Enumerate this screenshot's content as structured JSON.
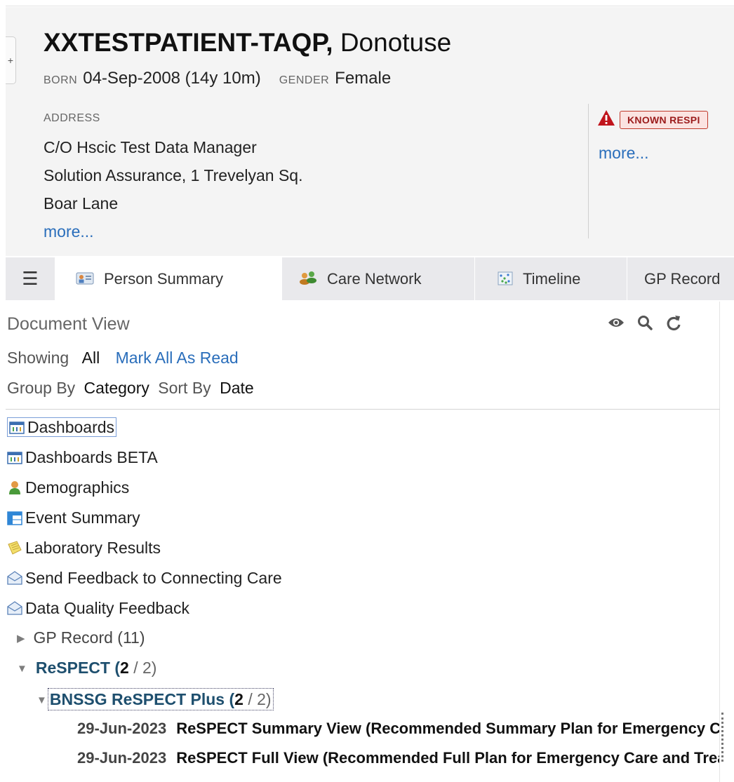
{
  "patient": {
    "surname": "XXTESTPATIENT-TAQP,",
    "forename": "Donotuse",
    "born_label": "BORN",
    "born_value": "04-Sep-2008 (14y 10m)",
    "gender_label": "GENDER",
    "gender_value": "Female",
    "address_label": "ADDRESS",
    "address_lines": [
      "C/O Hscic Test Data Manager",
      "Solution Assurance, 1 Trevelyan Sq.",
      "Boar Lane"
    ],
    "address_more": "more...",
    "alert_badge": "KNOWN RESPI",
    "alert_more": "more..."
  },
  "tabs": [
    {
      "label": "Person Summary",
      "icon": "person-summary-icon",
      "active": true
    },
    {
      "label": "Care Network",
      "icon": "care-network-icon",
      "active": false
    },
    {
      "label": "Timeline",
      "icon": "timeline-icon",
      "active": false
    },
    {
      "label": "GP Record",
      "icon": "",
      "active": false
    }
  ],
  "document_view": {
    "title": "Document View",
    "showing_label": "Showing",
    "showing_value": "All",
    "mark_all_read": "Mark All As Read",
    "group_by_label": "Group By",
    "group_by_value": "Category",
    "sort_by_label": "Sort By",
    "sort_by_value": "Date",
    "tool_icons": [
      "eye-icon",
      "search-icon",
      "refresh-icon"
    ]
  },
  "tree": {
    "items": [
      {
        "label": "Dashboards",
        "icon": "dashboard-icon"
      },
      {
        "label": "Dashboards BETA",
        "icon": "dashboard-icon"
      },
      {
        "label": "Demographics",
        "icon": "person-icon"
      },
      {
        "label": "Event Summary",
        "icon": "table-icon"
      },
      {
        "label": "Laboratory Results",
        "icon": "notes-icon"
      },
      {
        "label": "Send Feedback to Connecting Care",
        "icon": "envelope-icon"
      },
      {
        "label": "Data Quality Feedback",
        "icon": "envelope-icon"
      }
    ],
    "gp_record": "GP Record (11)",
    "respect": {
      "label": "ReSPECT",
      "unread": "2",
      "total": "2"
    },
    "bnssg": {
      "label": "BNSSG ReSPECT Plus",
      "unread": "2",
      "total": "2"
    },
    "documents": [
      {
        "date": "29-Jun-2023",
        "title": "ReSPECT Summary View (Recommended Summary Plan for Emergency Care and Treatment)"
      },
      {
        "date": "29-Jun-2023",
        "title": "ReSPECT Full View (Recommended Full Plan for Emergency Care and Treatment)"
      }
    ]
  },
  "colors": {
    "link": "#2a6ebb",
    "respect": "#1e4f6e",
    "alert": "#c0392b"
  }
}
